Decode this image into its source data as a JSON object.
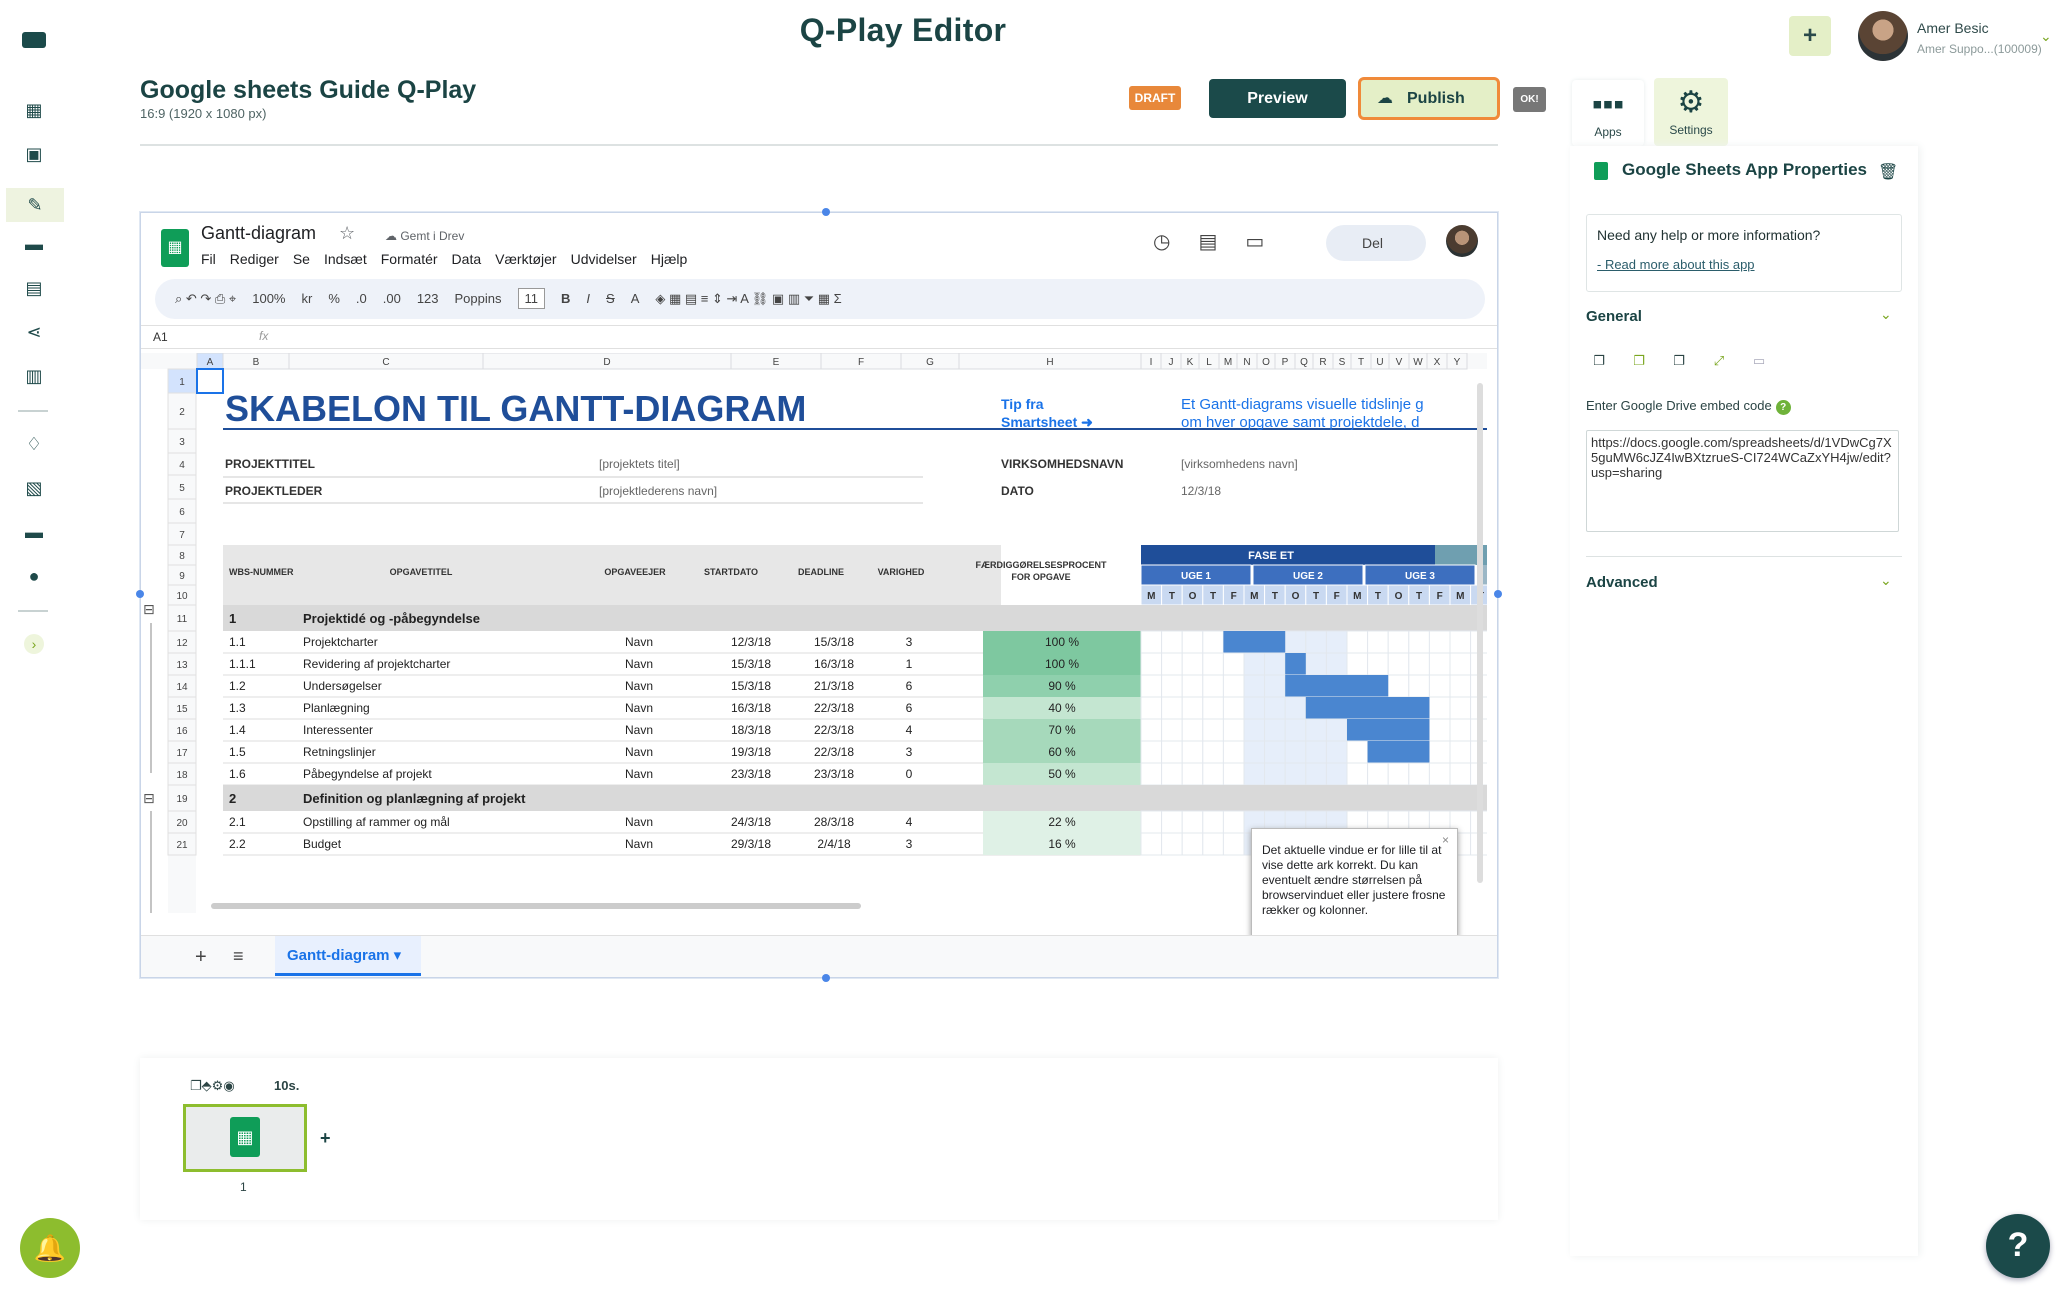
{
  "header": {
    "app_title": "Q-Play Editor",
    "add_label": "+",
    "user_name": "Amer Besic",
    "user_sub": "Amer Suppo...(100009)"
  },
  "document": {
    "title": "Google sheets Guide Q-Play",
    "subtitle": "16:9 (1920 x 1080 px)",
    "status": "DRAFT",
    "preview_label": "Preview",
    "publish_label": "Publish",
    "ok_label": "OK!"
  },
  "panel": {
    "tab_apps": "Apps",
    "tab_settings": "Settings",
    "title": "Google Sheets App Properties",
    "help_text": "Need any help or more information?",
    "help_link": "- Read more about this app",
    "general_label": "General",
    "embed_label": "Enter Google Drive embed code",
    "embed_value": "https://docs.google.com/spreadsheets/d/1VDwCg7X5guMW6cJZ4IwBXtzrueS-CI724WCaZxYH4jw/edit?usp=sharing",
    "advanced_label": "Advanced"
  },
  "sheet": {
    "title": "Gantt-diagram",
    "saved": "Gemt i Drev",
    "menus": [
      "Fil",
      "Rediger",
      "Se",
      "Indsæt",
      "Formatér",
      "Data",
      "Værktøjer",
      "Udvidelser",
      "Hjælp"
    ],
    "toolbar": [
      "100%",
      "kr",
      "%",
      ".0",
      ".00",
      "123",
      "Poppins",
      "11",
      "B",
      "I",
      "S",
      "A"
    ],
    "share_label": "Del",
    "cell_ref": "A1",
    "fx": "fx",
    "col_letters": [
      "A",
      "B",
      "C",
      "D",
      "E",
      "F",
      "G",
      "H",
      "I",
      "J",
      "K",
      "L",
      "M",
      "N",
      "O",
      "P",
      "Q",
      "R",
      "S",
      "T",
      "U",
      "V",
      "W",
      "X",
      "Y"
    ],
    "main_title": "SKABELON TIL GANTT-DIAGRAM",
    "tip_line1": "Tip fra",
    "tip_line2": "Smartsheet ➜",
    "tip_desc1": "Et Gantt-diagrams visuelle tidslinje g",
    "tip_desc2": "om hver opgave samt projektdele, d",
    "project_title_lbl": "PROJEKTTITEL",
    "project_title_val": "[projektets titel]",
    "project_lead_lbl": "PROJEKTLEDER",
    "project_lead_val": "[projektlederens navn]",
    "company_lbl": "VIRKSOMHEDSNAVN",
    "company_val": "[virksomhedens navn]",
    "date_lbl": "DATO",
    "date_val": "12/3/18",
    "headers": [
      "WBS-NUMMER",
      "OPGAVETITEL",
      "OPGAVEEJER",
      "STARTDATO",
      "DEADLINE",
      "VARIGHED",
      "FÆRDIGGØRELSESPROCENT FOR OPGAVE"
    ],
    "phase": "FASE ET",
    "weeks": [
      "UGE 1",
      "UGE 2",
      "UGE 3"
    ],
    "days": [
      "M",
      "T",
      "O",
      "T",
      "F",
      "M",
      "T",
      "O",
      "T",
      "F",
      "M",
      "T",
      "O",
      "T",
      "F",
      "M",
      "T"
    ],
    "rows": [
      {
        "n": "11",
        "section": true,
        "wbs": "1",
        "task": "Projektidé og -påbegyndelse"
      },
      {
        "n": "12",
        "wbs": "1.1",
        "task": "Projektcharter",
        "owner": "Navn",
        "start": "12/3/18",
        "end": "15/3/18",
        "dur": "3",
        "pct": "100 %",
        "p": 100,
        "g0": 4,
        "g1": 7
      },
      {
        "n": "13",
        "wbs": "1.1.1",
        "task": "Revidering af projektcharter",
        "owner": "Navn",
        "start": "15/3/18",
        "end": "16/3/18",
        "dur": "1",
        "pct": "100 %",
        "p": 100,
        "g0": 7,
        "g1": 8
      },
      {
        "n": "14",
        "wbs": "1.2",
        "task": "Undersøgelser",
        "owner": "Navn",
        "start": "15/3/18",
        "end": "21/3/18",
        "dur": "6",
        "pct": "90 %",
        "p": 90,
        "g0": 7,
        "g1": 12
      },
      {
        "n": "15",
        "wbs": "1.3",
        "task": "Planlægning",
        "owner": "Navn",
        "start": "16/3/18",
        "end": "22/3/18",
        "dur": "6",
        "pct": "40 %",
        "p": 40,
        "g0": 8,
        "g1": 14
      },
      {
        "n": "16",
        "wbs": "1.4",
        "task": "Interessenter",
        "owner": "Navn",
        "start": "18/3/18",
        "end": "22/3/18",
        "dur": "4",
        "pct": "70 %",
        "p": 70,
        "g0": 10,
        "g1": 14
      },
      {
        "n": "17",
        "wbs": "1.5",
        "task": "Retningslinjer",
        "owner": "Navn",
        "start": "19/3/18",
        "end": "22/3/18",
        "dur": "3",
        "pct": "60 %",
        "p": 60,
        "g0": 11,
        "g1": 14
      },
      {
        "n": "18",
        "wbs": "1.6",
        "task": "Påbegyndelse af projekt",
        "owner": "Navn",
        "start": "23/3/18",
        "end": "23/3/18",
        "dur": "0",
        "pct": "50 %",
        "p": 50,
        "g0": 0,
        "g1": 0
      },
      {
        "n": "19",
        "section": true,
        "wbs": "2",
        "task": "Definition og planlægning af projekt"
      },
      {
        "n": "20",
        "wbs": "2.1",
        "task": "Opstilling af rammer og mål",
        "owner": "Navn",
        "start": "24/3/18",
        "end": "28/3/18",
        "dur": "4",
        "pct": "22 %",
        "p": 22,
        "g0": 0,
        "g1": 0
      },
      {
        "n": "21",
        "wbs": "2.2",
        "task": "Budget",
        "owner": "Navn",
        "start": "29/3/18",
        "end": "2/4/18",
        "dur": "3",
        "pct": "16 %",
        "p": 16,
        "g0": 0,
        "g1": 0
      }
    ],
    "tooltip": "Det aktuelle vindue er for lille til at vise dette ark korrekt. Du kan eventuelt ændre størrelsen på browservinduet eller justere frosne rækker og kolonner.",
    "tab_name": "Gantt-diagram"
  },
  "thumbs": {
    "duration": "10s.",
    "number": "1"
  }
}
